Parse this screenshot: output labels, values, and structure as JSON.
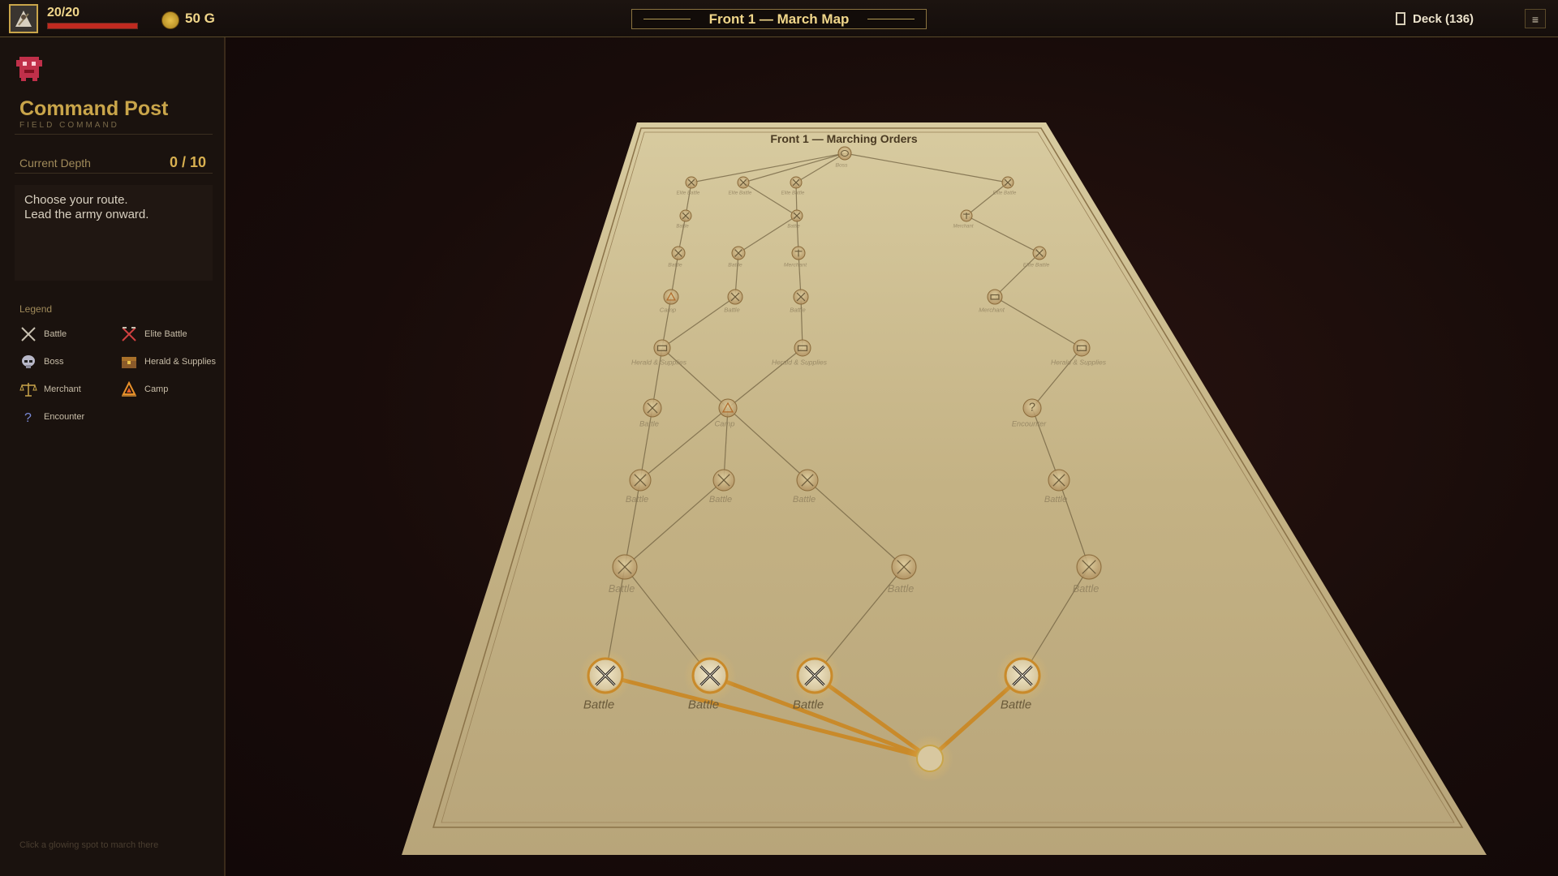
{
  "topbar": {
    "hp_text": "20/20",
    "hp_fraction": 1.0,
    "gold_text": "50 G",
    "title": "Front 1 — March Map",
    "deck_text": "Deck (136)",
    "menu_icon": "≡"
  },
  "sidebar": {
    "title": "Command Post",
    "subtitle": "FIELD COMMAND",
    "depth_label": "Current Depth",
    "depth_value": "0 / 10",
    "message_line1": "Choose your route.",
    "message_line2": "Lead the army onward.",
    "legend_title": "Legend",
    "legend": [
      {
        "label": "Battle",
        "icon": "crossed-swords-icon"
      },
      {
        "label": "Elite Battle",
        "icon": "elite-swords-icon"
      },
      {
        "label": "Boss",
        "icon": "skull-helm-icon"
      },
      {
        "label": "Herald & Supplies",
        "icon": "chest-icon"
      },
      {
        "label": "Merchant",
        "icon": "scales-icon"
      },
      {
        "label": "Camp",
        "icon": "campfire-icon"
      },
      {
        "label": "Encounter",
        "icon": "question-icon"
      }
    ],
    "hint": "Click a glowing spot to march there"
  },
  "map": {
    "board_title": "Front 1 — Marching Orders",
    "labels": {
      "battle": "Battle",
      "camp": "Camp",
      "herald": "Herald & Supplies",
      "encounter": "Encounter",
      "merchant": "Merchant",
      "elite": "Elite Battle",
      "boss": "Boss"
    },
    "colors": {
      "path_active": "#c98a2a",
      "parchment": "#c8b68a",
      "accent_gold": "#c9a54a"
    }
  }
}
